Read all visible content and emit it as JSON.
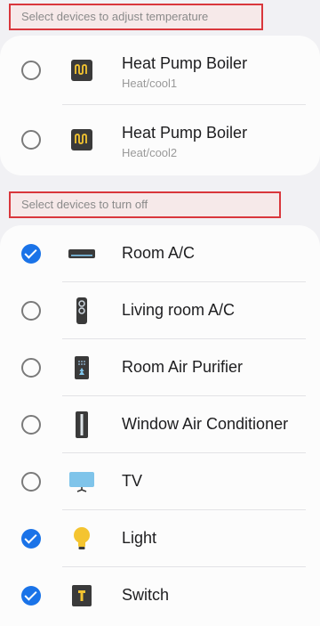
{
  "section_adjust": {
    "title": "Select devices to adjust temperature",
    "devices": [
      {
        "name": "Heat Pump Boiler",
        "sub": "Heat/cool1",
        "checked": false,
        "icon": "boiler-icon"
      },
      {
        "name": "Heat Pump Boiler",
        "sub": "Heat/cool2",
        "checked": false,
        "icon": "boiler-icon"
      }
    ]
  },
  "section_off": {
    "title": "Select devices to turn off",
    "devices": [
      {
        "name": "Room A/C",
        "checked": true,
        "icon": "wall-ac-icon"
      },
      {
        "name": "Living room A/C",
        "checked": false,
        "icon": "standing-ac-icon"
      },
      {
        "name": "Room Air Purifier",
        "checked": false,
        "icon": "air-purifier-icon"
      },
      {
        "name": "Window Air Conditioner",
        "checked": false,
        "icon": "window-ac-icon"
      },
      {
        "name": "TV",
        "checked": false,
        "icon": "tv-icon"
      },
      {
        "name": "Light",
        "checked": true,
        "icon": "light-bulb-icon"
      },
      {
        "name": "Switch",
        "checked": true,
        "icon": "switch-icon"
      }
    ]
  },
  "colors": {
    "accent": "#1a73e8",
    "highlight_border": "#d9373c",
    "icon_dark": "#3a3a3a",
    "icon_yellow": "#f4c430",
    "tv_blue": "#7fc4ea"
  }
}
